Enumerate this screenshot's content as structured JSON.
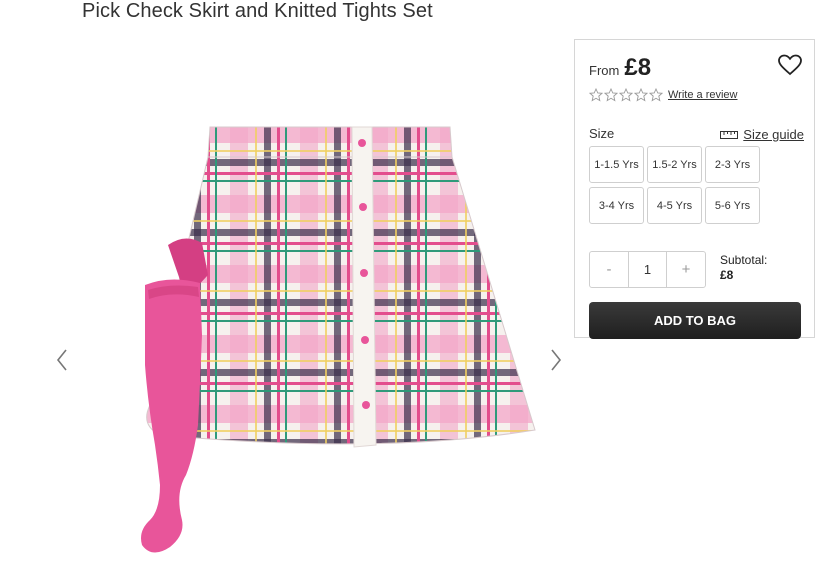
{
  "product": {
    "title": "Pick Check Skirt and Knitted Tights Set"
  },
  "price": {
    "from_label": "From",
    "value": "£8"
  },
  "rating": {
    "stars": 0,
    "max_stars": 5,
    "review_link": "Write a review"
  },
  "size": {
    "label": "Size",
    "guide_label": "Size guide",
    "options": [
      "1-1.5 Yrs",
      "1.5-2 Yrs",
      "2-3 Yrs",
      "3-4 Yrs",
      "4-5 Yrs",
      "5-6 Yrs"
    ]
  },
  "quantity": {
    "minus": "-",
    "value": "1",
    "plus": "+"
  },
  "subtotal": {
    "label": "Subtotal:",
    "value": "£8"
  },
  "actions": {
    "add_to_bag": "ADD TO BAG"
  },
  "icons": {
    "wishlist": "heart-icon",
    "prev": "chevron-left-icon",
    "next": "chevron-right-icon",
    "size_guide": "ruler-icon",
    "rating": "star-icon"
  },
  "colors": {
    "button_bg": "#2c2c2c",
    "accent_pink": "#e8559a"
  }
}
